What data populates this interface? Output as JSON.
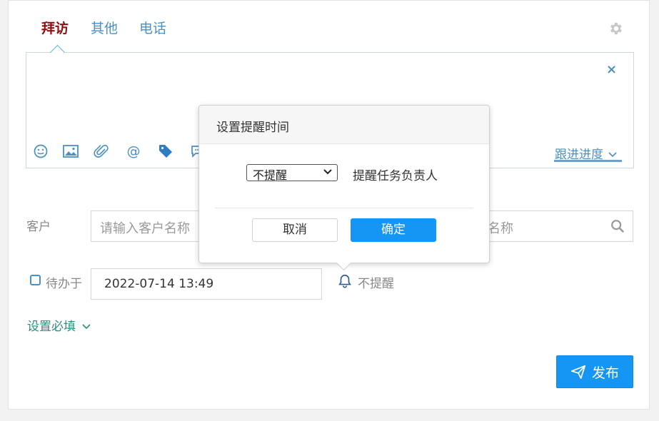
{
  "tabs": [
    {
      "label": "拜访"
    },
    {
      "label": "其他"
    },
    {
      "label": "电话"
    }
  ],
  "editor": {
    "close_label": "×",
    "progress_label": "跟进进度"
  },
  "form": {
    "customer_label": "客户",
    "customer_placeholder": "请输入客户名称",
    "contact_placeholder_visible": "名称",
    "todo_label": "待办于",
    "todo_datetime": "2022-07-14 13:49",
    "remind_status": "不提醒",
    "set_required_label": "设置必填",
    "publish_label": "发布"
  },
  "dialog": {
    "title": "设置提醒时间",
    "select_value": "不提醒",
    "description": "提醒任务负责人",
    "cancel_label": "取消",
    "ok_label": "确定"
  },
  "colors": {
    "active_tab": "#8b1010",
    "link_blue": "#4a90c2",
    "primary_button": "#1596f5",
    "teal_link": "#2a8d7d"
  },
  "icons": [
    "gear-icon",
    "smile-icon",
    "image-icon",
    "paperclip-icon",
    "at-icon",
    "tag-icon",
    "comment-icon",
    "chevron-down-icon",
    "search-icon",
    "bell-icon",
    "paper-plane-icon"
  ]
}
